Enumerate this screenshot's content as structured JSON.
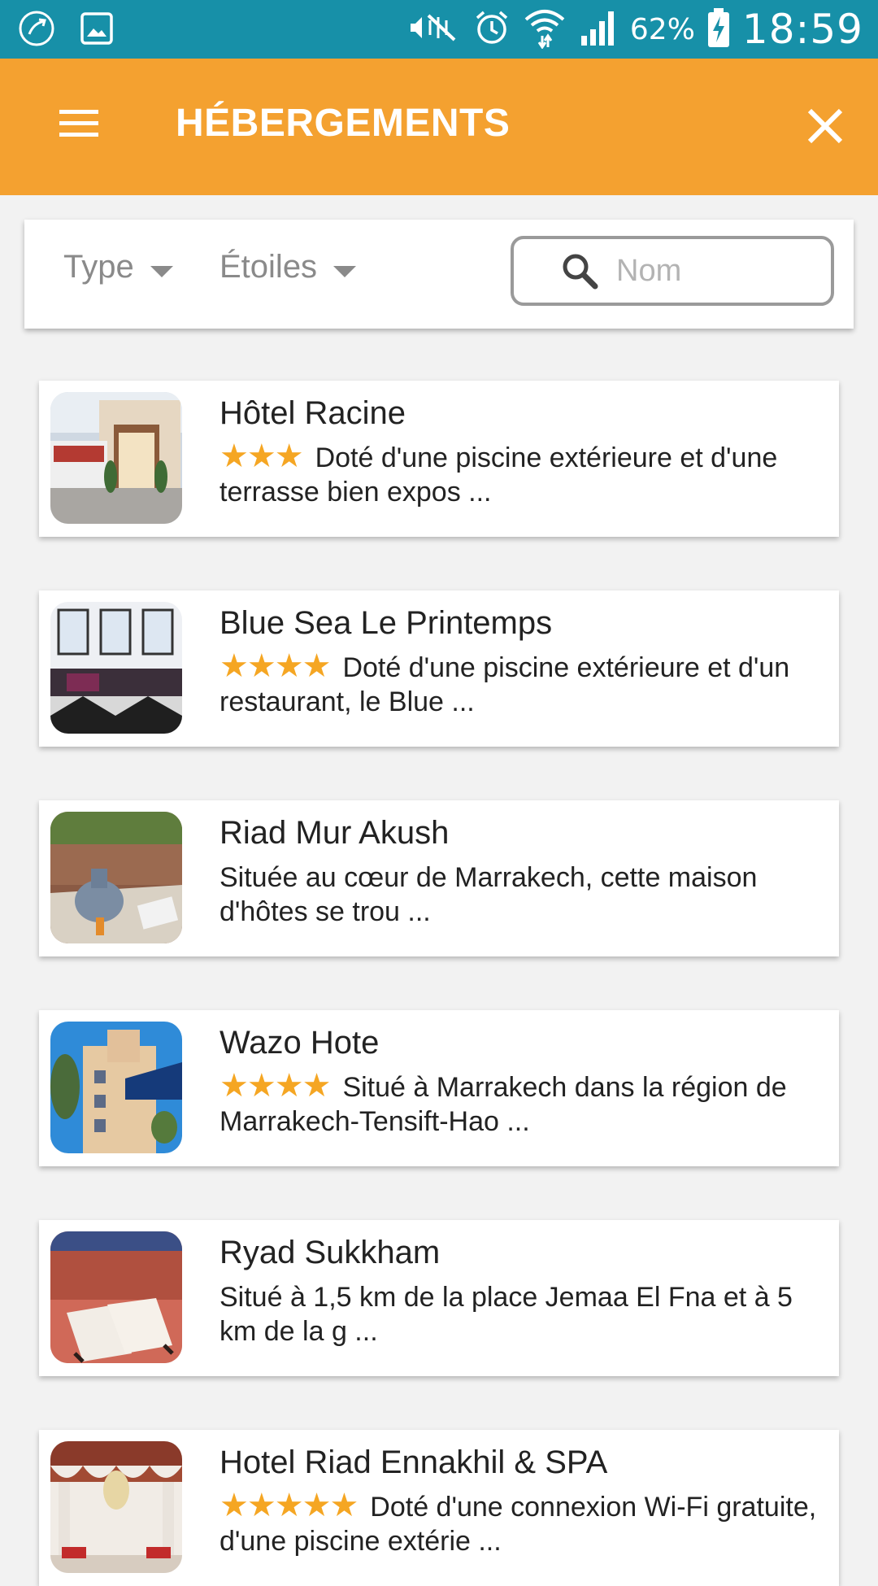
{
  "status_bar": {
    "battery": "62%",
    "time": "18:59"
  },
  "app_bar": {
    "title": "HÉBERGEMENTS"
  },
  "filters": {
    "type_label": "Type",
    "stars_label": "Étoiles",
    "search_placeholder": "Nom",
    "search_value": ""
  },
  "listings": [
    {
      "name": "Hôtel Racine",
      "stars": "★★★",
      "description": "Doté d'une piscine extérieure et d'une terrasse bien expos ..."
    },
    {
      "name": "Blue Sea Le Printemps",
      "stars": "★★★★",
      "description": "Doté d'une piscine extérieure et d'un restaurant, le Blue ..."
    },
    {
      "name": "Riad Mur Akush",
      "stars": "",
      "description": "Située au cœur de Marrakech, cette maison d'hôtes se trou ..."
    },
    {
      "name": "Wazo Hote",
      "stars": "★★★★",
      "description": "Situé à Marrakech dans la région de Marrakech-Tensift-Hao ..."
    },
    {
      "name": "Ryad Sukkham",
      "stars": "",
      "description": "Situé à 1,5 km de la place Jemaa El Fna et à 5 km de la g ..."
    },
    {
      "name": "Hotel Riad Ennakhil & SPA",
      "stars": "★★★★★",
      "description": "Doté d'une connexion Wi-Fi gratuite, d'une piscine extérie ..."
    }
  ],
  "colors": {
    "status_bar": "#1790a8",
    "app_bar": "#f4a130",
    "star": "#f5a623"
  }
}
